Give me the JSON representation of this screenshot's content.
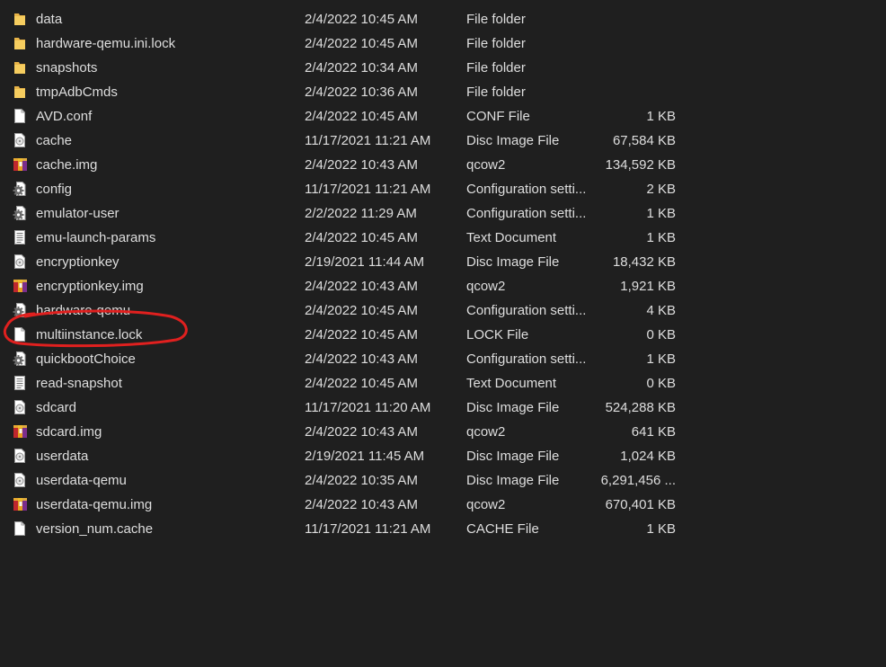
{
  "files": [
    {
      "name": "data",
      "date": "2/4/2022 10:45 AM",
      "type": "File folder",
      "size": "",
      "icon": "folder-icon"
    },
    {
      "name": "hardware-qemu.ini.lock",
      "date": "2/4/2022 10:45 AM",
      "type": "File folder",
      "size": "",
      "icon": "folder-icon"
    },
    {
      "name": "snapshots",
      "date": "2/4/2022 10:34 AM",
      "type": "File folder",
      "size": "",
      "icon": "folder-icon"
    },
    {
      "name": "tmpAdbCmds",
      "date": "2/4/2022 10:36 AM",
      "type": "File folder",
      "size": "",
      "icon": "folder-icon"
    },
    {
      "name": "AVD.conf",
      "date": "2/4/2022 10:45 AM",
      "type": "CONF File",
      "size": "1 KB",
      "icon": "blank-file-icon"
    },
    {
      "name": "cache",
      "date": "11/17/2021 11:21 AM",
      "type": "Disc Image File",
      "size": "67,584 KB",
      "icon": "disc-image-icon"
    },
    {
      "name": "cache.img",
      "date": "2/4/2022 10:43 AM",
      "type": "qcow2",
      "size": "134,592 KB",
      "icon": "archive-icon"
    },
    {
      "name": "config",
      "date": "11/17/2021 11:21 AM",
      "type": "Configuration setti...",
      "size": "2 KB",
      "icon": "config-gear-icon"
    },
    {
      "name": "emulator-user",
      "date": "2/2/2022 11:29 AM",
      "type": "Configuration setti...",
      "size": "1 KB",
      "icon": "config-gear-icon"
    },
    {
      "name": "emu-launch-params",
      "date": "2/4/2022 10:45 AM",
      "type": "Text Document",
      "size": "1 KB",
      "icon": "text-document-icon"
    },
    {
      "name": "encryptionkey",
      "date": "2/19/2021 11:44 AM",
      "type": "Disc Image File",
      "size": "18,432 KB",
      "icon": "disc-image-icon"
    },
    {
      "name": "encryptionkey.img",
      "date": "2/4/2022 10:43 AM",
      "type": "qcow2",
      "size": "1,921 KB",
      "icon": "archive-icon"
    },
    {
      "name": "hardware-qemu",
      "date": "2/4/2022 10:45 AM",
      "type": "Configuration setti...",
      "size": "4 KB",
      "icon": "config-gear-icon"
    },
    {
      "name": "multiinstance.lock",
      "date": "2/4/2022 10:45 AM",
      "type": "LOCK File",
      "size": "0 KB",
      "icon": "blank-file-icon"
    },
    {
      "name": "quickbootChoice",
      "date": "2/4/2022 10:43 AM",
      "type": "Configuration setti...",
      "size": "1 KB",
      "icon": "config-gear-icon"
    },
    {
      "name": "read-snapshot",
      "date": "2/4/2022 10:45 AM",
      "type": "Text Document",
      "size": "0 KB",
      "icon": "text-document-icon"
    },
    {
      "name": "sdcard",
      "date": "11/17/2021 11:20 AM",
      "type": "Disc Image File",
      "size": "524,288 KB",
      "icon": "disc-image-icon"
    },
    {
      "name": "sdcard.img",
      "date": "2/4/2022 10:43 AM",
      "type": "qcow2",
      "size": "641 KB",
      "icon": "archive-icon"
    },
    {
      "name": "userdata",
      "date": "2/19/2021 11:45 AM",
      "type": "Disc Image File",
      "size": "1,024 KB",
      "icon": "disc-image-icon"
    },
    {
      "name": "userdata-qemu",
      "date": "2/4/2022 10:35 AM",
      "type": "Disc Image File",
      "size": "6,291,456 ...",
      "icon": "disc-image-icon"
    },
    {
      "name": "userdata-qemu.img",
      "date": "2/4/2022 10:43 AM",
      "type": "qcow2",
      "size": "670,401 KB",
      "icon": "archive-icon"
    },
    {
      "name": "version_num.cache",
      "date": "11/17/2021 11:21 AM",
      "type": "CACHE File",
      "size": "1 KB",
      "icon": "blank-file-icon"
    }
  ],
  "colors": {
    "background": "#1f1f1f",
    "text": "#dedede",
    "folder": "#f2c55c",
    "annotation": "#e0201f"
  }
}
